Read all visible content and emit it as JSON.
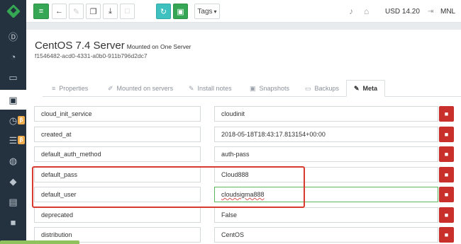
{
  "sidebar": {
    "logo": "cloudsigma-logo-icon",
    "items": [
      {
        "icon": "dashboard-icon",
        "glyph": "Ⓓ"
      },
      {
        "icon": "gauge-icon",
        "glyph": "◔"
      },
      {
        "icon": "desktop-icon",
        "glyph": "▭"
      },
      {
        "icon": "drive-icon",
        "glyph": "▣"
      },
      {
        "icon": "clock-icon",
        "glyph": "◷",
        "beta": "β"
      },
      {
        "icon": "server-list-icon",
        "glyph": "☰",
        "beta": "β"
      },
      {
        "icon": "globe-icon",
        "glyph": "◍"
      },
      {
        "icon": "tags-icon",
        "glyph": "◆"
      },
      {
        "icon": "billing-icon",
        "glyph": "▤"
      },
      {
        "icon": "lock-icon",
        "glyph": "■"
      }
    ]
  },
  "toolbar": {
    "menu_glyph": "≡",
    "back_glyph": "←",
    "link_glyph": "✎",
    "clone_glyph": "❐",
    "download_glyph": "⤓",
    "delete_glyph": "□",
    "refresh_glyph": "↻",
    "save_glyph": "▣",
    "tags_label": "Tags",
    "caret": "▾",
    "bell_glyph": "♪",
    "cap_glyph": "⌂",
    "balance": "USD 14.20",
    "exit_glyph": "⇥",
    "location": "MNL"
  },
  "server": {
    "name": "CentOS 7.4 Server",
    "mount_status": "Mounted on One Server",
    "uuid": "f1546482-acd0-4331-a0b0-911b796d2dc7"
  },
  "tabs": [
    {
      "label": "Properties",
      "icon": "≡"
    },
    {
      "label": "Mounted on servers",
      "icon": "✐"
    },
    {
      "label": "Install notes",
      "icon": "✎"
    },
    {
      "label": "Snapshots",
      "icon": "▣"
    },
    {
      "label": "Backups",
      "icon": "▭"
    },
    {
      "label": "Meta",
      "icon": "✎"
    }
  ],
  "meta": [
    {
      "key": "cloud_init_service",
      "value": "cloudinit"
    },
    {
      "key": "created_at",
      "value": "2018-05-18T18:43:17.813154+00:00"
    },
    {
      "key": "default_auth_method",
      "value": "auth-pass"
    },
    {
      "key": "default_pass",
      "value": "Cloud888"
    },
    {
      "key": "default_user",
      "value": "cloudsigma888"
    },
    {
      "key": "deprecated",
      "value": "False"
    },
    {
      "key": "distribution",
      "value": "CentOS"
    }
  ],
  "delete_glyph": "■",
  "colors": {
    "brand_green": "#35a653",
    "teal": "#3fc1c0",
    "danger": "#c9302c",
    "highlight": "#d93a2f",
    "sidebar": "#24323f"
  }
}
